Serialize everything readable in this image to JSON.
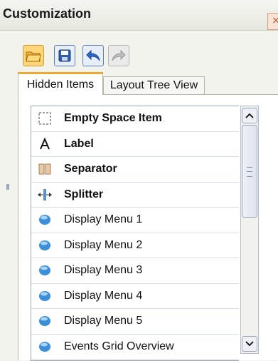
{
  "window": {
    "title": "Customization",
    "close_glyph": "×"
  },
  "toolbar": [
    {
      "name": "open-button",
      "icon": "folder-open-icon"
    },
    {
      "name": "save-button",
      "icon": "floppy-disk-icon"
    },
    {
      "name": "undo-button",
      "icon": "undo-arrow-icon"
    },
    {
      "name": "redo-button",
      "icon": "redo-arrow-icon",
      "disabled": true
    }
  ],
  "tabs": [
    {
      "label": "Hidden Items",
      "active": true
    },
    {
      "label": "Layout Tree View",
      "active": false
    }
  ],
  "hidden_items": [
    {
      "label": "Empty Space Item",
      "icon": "empty-space-icon",
      "bold": true
    },
    {
      "label": "Label",
      "icon": "label-a-icon",
      "bold": true
    },
    {
      "label": "Separator",
      "icon": "separator-icon",
      "bold": true
    },
    {
      "label": "Splitter",
      "icon": "splitter-icon",
      "bold": true
    },
    {
      "label": "Display Menu 1",
      "icon": "blue-ball-icon",
      "bold": false
    },
    {
      "label": "Display Menu 2",
      "icon": "blue-ball-icon",
      "bold": false
    },
    {
      "label": "Display Menu 3",
      "icon": "blue-ball-icon",
      "bold": false
    },
    {
      "label": "Display Menu 4",
      "icon": "blue-ball-icon",
      "bold": false
    },
    {
      "label": "Display Menu 5",
      "icon": "blue-ball-icon",
      "bold": false
    },
    {
      "label": "Events Grid Overview",
      "icon": "blue-ball-icon",
      "bold": false
    }
  ],
  "colors": {
    "accent_tab": "#f2a531",
    "item_ball": "#3b8fd9"
  }
}
